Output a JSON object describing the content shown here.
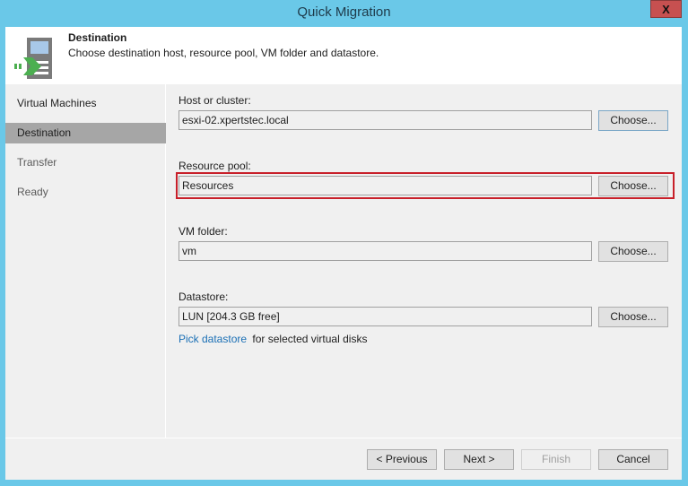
{
  "window": {
    "title": "Quick Migration",
    "close_label": "X"
  },
  "header": {
    "icon": "server-migration-icon",
    "title": "Destination",
    "description": "Choose destination host, resource pool, VM folder and datastore."
  },
  "sidebar": {
    "items": [
      {
        "label": "Virtual Machines",
        "state": "done"
      },
      {
        "label": "Destination",
        "state": "active"
      },
      {
        "label": "Transfer",
        "state": "pending"
      },
      {
        "label": "Ready",
        "state": "pending"
      }
    ]
  },
  "form": {
    "host": {
      "label": "Host or cluster:",
      "value": "esxi-02.xpertstec.local",
      "button": "Choose..."
    },
    "resource_pool": {
      "label": "Resource pool:",
      "value": "Resources",
      "button": "Choose..."
    },
    "vm_folder": {
      "label": "VM folder:",
      "value": "vm",
      "button": "Choose..."
    },
    "datastore": {
      "label": "Datastore:",
      "value": "LUN [204.3 GB free]",
      "button": "Choose..."
    },
    "pick_link": "Pick datastore",
    "pick_suffix": "for selected virtual disks"
  },
  "highlight_color": "#c8202a",
  "footer": {
    "previous": "< Previous",
    "next": "Next >",
    "finish": "Finish",
    "cancel": "Cancel"
  }
}
